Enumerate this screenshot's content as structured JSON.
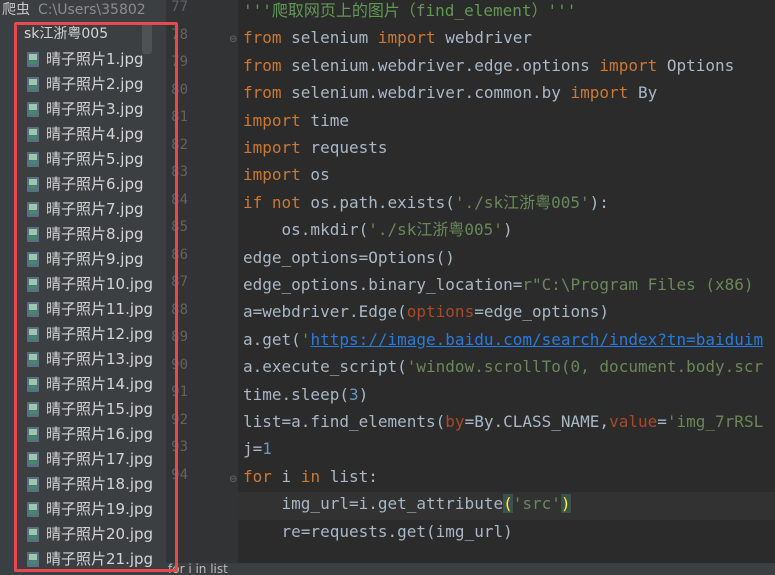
{
  "project": {
    "name": "爬虫",
    "path": "C:\\Users\\35802",
    "folder": "sk江浙粤005",
    "files": [
      "晴子照片1.jpg",
      "晴子照片2.jpg",
      "晴子照片3.jpg",
      "晴子照片4.jpg",
      "晴子照片5.jpg",
      "晴子照片6.jpg",
      "晴子照片7.jpg",
      "晴子照片8.jpg",
      "晴子照片9.jpg",
      "晴子照片10.jpg",
      "晴子照片11.jpg",
      "晴子照片12.jpg",
      "晴子照片13.jpg",
      "晴子照片14.jpg",
      "晴子照片15.jpg",
      "晴子照片16.jpg",
      "晴子照片17.jpg",
      "晴子照片18.jpg",
      "晴子照片19.jpg",
      "晴子照片20.jpg",
      "晴子照片21.jpg"
    ],
    "file_icon": "image-file-icon"
  },
  "gutter": {
    "line_numbers": [
      "77",
      "78",
      "79",
      "80",
      "81",
      "82",
      "83",
      "84",
      "85",
      "86",
      "87",
      "88",
      "89",
      "90",
      "91",
      "92",
      "93",
      "94"
    ]
  },
  "editor": {
    "lines": [
      [
        {
          "t": "'''爬取网页上的图片（find_element）'''",
          "c": "doc"
        }
      ],
      [
        {
          "t": "from",
          "c": "kw"
        },
        {
          "t": " selenium ",
          "c": ""
        },
        {
          "t": "import",
          "c": "kw"
        },
        {
          "t": " webdriver",
          "c": ""
        }
      ],
      [
        {
          "t": "from",
          "c": "kw"
        },
        {
          "t": " selenium.webdriver.edge.options ",
          "c": ""
        },
        {
          "t": "import",
          "c": "kw"
        },
        {
          "t": " Options",
          "c": ""
        }
      ],
      [
        {
          "t": "from",
          "c": "kw"
        },
        {
          "t": " selenium.webdriver.common.by ",
          "c": ""
        },
        {
          "t": "import",
          "c": "kw"
        },
        {
          "t": " By",
          "c": ""
        }
      ],
      [
        {
          "t": "import",
          "c": "kw"
        },
        {
          "t": " time",
          "c": ""
        }
      ],
      [
        {
          "t": "import",
          "c": "kw"
        },
        {
          "t": " requests",
          "c": ""
        }
      ],
      [
        {
          "t": "import",
          "c": "kw"
        },
        {
          "t": " os",
          "c": ""
        }
      ],
      [
        {
          "t": "if not",
          "c": "kw"
        },
        {
          "t": " os.path.exists(",
          "c": ""
        },
        {
          "t": "'./sk江浙粤005'",
          "c": "str"
        },
        {
          "t": "):",
          "c": ""
        }
      ],
      [
        {
          "t": "    os.mkdir(",
          "c": ""
        },
        {
          "t": "'./sk江浙粤005'",
          "c": "str"
        },
        {
          "t": ")",
          "c": ""
        }
      ],
      [
        {
          "t": "edge_options=Options()",
          "c": ""
        }
      ],
      [
        {
          "t": "edge_options.binary_location=",
          "c": ""
        },
        {
          "t": "r\"C:\\Program Files (x86)",
          "c": "str"
        }
      ],
      [
        {
          "t": "a=webdriver.Edge(",
          "c": ""
        },
        {
          "t": "options",
          "c": "param"
        },
        {
          "t": "=edge_options)",
          "c": ""
        }
      ],
      [
        {
          "t": "a.get(",
          "c": ""
        },
        {
          "t": "'",
          "c": "str"
        },
        {
          "t": "https://image.baidu.com/search/index?tn=baiduim",
          "c": "url"
        }
      ],
      [
        {
          "t": "a.execute_script(",
          "c": ""
        },
        {
          "t": "'window.scrollTo(0, document.body.scr",
          "c": "str"
        }
      ],
      [
        {
          "t": "time.sleep(",
          "c": ""
        },
        {
          "t": "3",
          "c": "num"
        },
        {
          "t": ")",
          "c": ""
        }
      ],
      [
        {
          "t": "list=a.find_elements(",
          "c": ""
        },
        {
          "t": "by",
          "c": "param"
        },
        {
          "t": "=By.CLASS_NAME,",
          "c": ""
        },
        {
          "t": "value",
          "c": "param"
        },
        {
          "t": "=",
          "c": ""
        },
        {
          "t": "'img_7rRSL",
          "c": "str"
        }
      ],
      [
        {
          "t": "j=",
          "c": ""
        },
        {
          "t": "1",
          "c": "num"
        }
      ],
      [
        {
          "t": "for",
          "c": "kw"
        },
        {
          "t": " i ",
          "c": ""
        },
        {
          "t": "in",
          "c": "kw"
        },
        {
          "t": " list:",
          "c": ""
        }
      ],
      [
        {
          "t": "    img_url=i.get_attribute",
          "c": ""
        },
        {
          "t": "(",
          "c": "paren-hl"
        },
        {
          "t": "'src'",
          "c": "str"
        },
        {
          "t": ")",
          "c": "paren-hl"
        }
      ],
      [
        {
          "t": "    re=requests.get(img_url)",
          "c": ""
        }
      ]
    ]
  },
  "status_bar": {
    "text": "for i in list"
  },
  "colors": {
    "highlight_box": "#e8484f",
    "keyword": "#cc7832",
    "string": "#6a8759",
    "background": "#2b2b2b"
  }
}
